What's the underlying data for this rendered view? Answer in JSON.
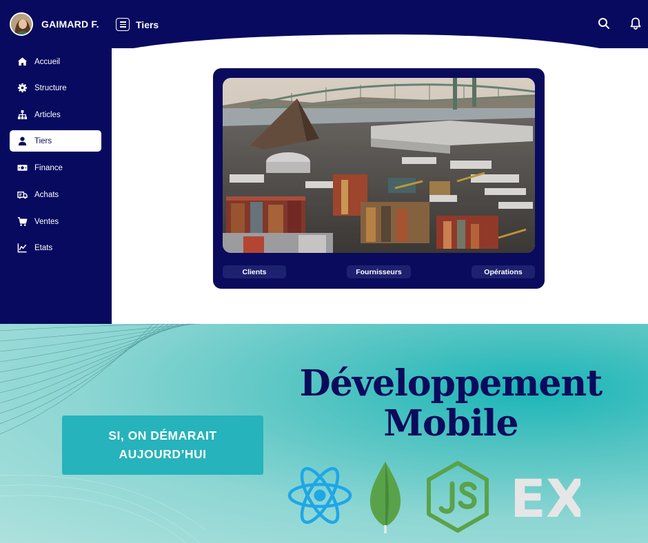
{
  "user": {
    "name": "GAIMARD F."
  },
  "header": {
    "title": "Tiers"
  },
  "sidebar": {
    "items": [
      {
        "label": "Accueil",
        "icon": "home-icon"
      },
      {
        "label": "Structure",
        "icon": "gear-icon"
      },
      {
        "label": "Articles",
        "icon": "sitemap-icon"
      },
      {
        "label": "Tiers",
        "icon": "user-icon",
        "active": true
      },
      {
        "label": "Finance",
        "icon": "money-icon"
      },
      {
        "label": "Achats",
        "icon": "truck-icon"
      },
      {
        "label": "Ventes",
        "icon": "cart-icon"
      },
      {
        "label": "Etats",
        "icon": "chart-line-icon"
      }
    ]
  },
  "card": {
    "buttons": [
      {
        "label": "Clients"
      },
      {
        "label": "Fournisseurs"
      },
      {
        "label": "Opérations"
      }
    ]
  },
  "promo": {
    "tagline_line1": "SI, ON DÉMARAIT",
    "tagline_line2": "AUJOURD’HUI",
    "headline_line1": "Développement",
    "headline_line2": "Mobile",
    "ex_logo_text": "EX"
  },
  "colors": {
    "navy": "#070a5e",
    "teal": "#26b3bb",
    "react": "#1ea7e8",
    "mongo": "#5aa24a",
    "node": "#5aa24a"
  }
}
